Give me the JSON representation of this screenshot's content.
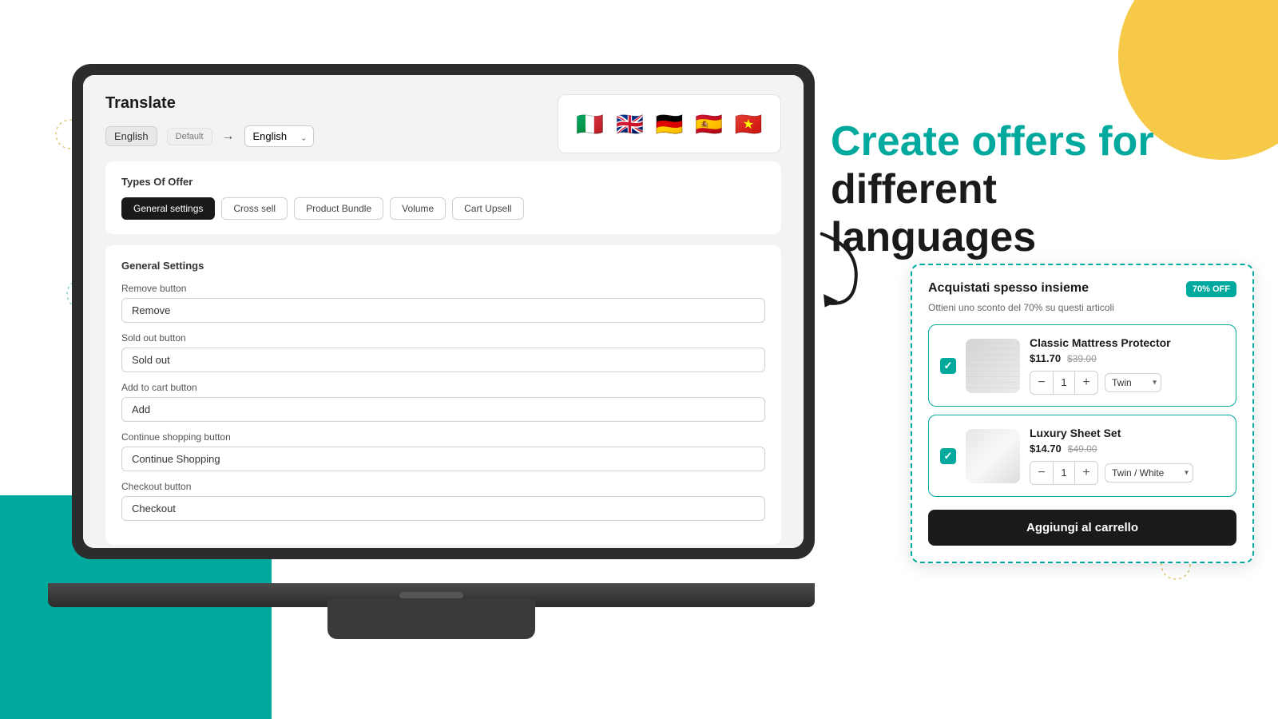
{
  "page": {
    "background_color": "#ffffff"
  },
  "translate_panel": {
    "title": "Translate",
    "source_lang": "English",
    "source_default": "Default",
    "arrow": "→",
    "target_lang": "English",
    "target_lang_chevron": "⌃"
  },
  "flags": {
    "items": [
      "🇮🇹",
      "🇬🇧",
      "🇩🇪",
      "🇪🇸",
      "🇻🇳"
    ]
  },
  "offer_types": {
    "section_label": "Types Of Offer",
    "tabs": [
      {
        "id": "general",
        "label": "General settings",
        "active": true
      },
      {
        "id": "cross",
        "label": "Cross sell",
        "active": false
      },
      {
        "id": "bundle",
        "label": "Product Bundle",
        "active": false
      },
      {
        "id": "volume",
        "label": "Volume",
        "active": false
      },
      {
        "id": "cart",
        "label": "Cart Upsell",
        "active": false
      }
    ]
  },
  "general_settings": {
    "title": "General Settings",
    "fields": [
      {
        "id": "remove",
        "label": "Remove button",
        "value": "Remove"
      },
      {
        "id": "sold_out",
        "label": "Sold out button",
        "value": "Sold out"
      },
      {
        "id": "add_to_cart",
        "label": "Add to cart button",
        "value": "Add"
      },
      {
        "id": "continue",
        "label": "Continue shopping button",
        "value": "Continue Shopping"
      },
      {
        "id": "checkout",
        "label": "Checkout button",
        "value": "Checkout"
      }
    ]
  },
  "offer_widget": {
    "title": "Acquistati spesso insieme",
    "discount_badge": "70% OFF",
    "subtitle": "Ottieni uno sconto del 70% su questi articoli",
    "products": [
      {
        "name": "Classic Mattress Protector",
        "price_current": "$11.70",
        "price_original": "$39.00",
        "qty": 1,
        "variant": "Twin",
        "checked": true
      },
      {
        "name": "Luxury Sheet Set",
        "price_current": "$14.70",
        "price_original": "$49.00",
        "qty": 1,
        "variant": "Twin / White",
        "checked": true
      }
    ],
    "add_to_cart_label": "Aggiungi al carrello"
  },
  "right_text": {
    "line1": "Create offers for",
    "line2": "different",
    "line3": "languages"
  }
}
